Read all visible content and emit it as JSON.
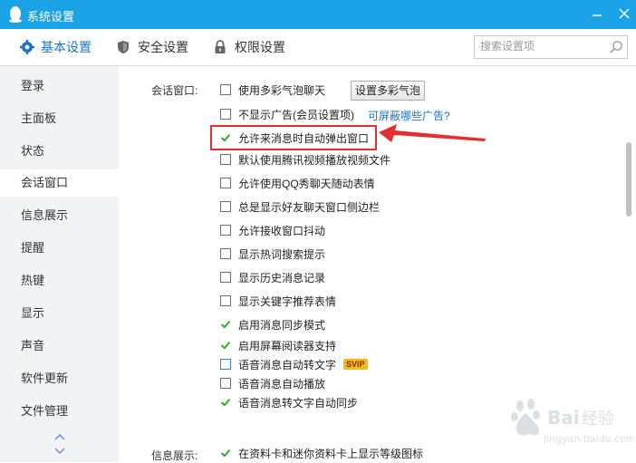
{
  "window": {
    "title": "系统设置"
  },
  "tabs": [
    {
      "label": "基本设置",
      "icon": "gear-icon"
    },
    {
      "label": "安全设置",
      "icon": "shield-icon"
    },
    {
      "label": "权限设置",
      "icon": "lock-icon"
    }
  ],
  "search": {
    "placeholder": "搜索设置项"
  },
  "sidebar": {
    "items": [
      {
        "label": "登录"
      },
      {
        "label": "主面板"
      },
      {
        "label": "状态"
      },
      {
        "label": "会话窗口"
      },
      {
        "label": "信息展示"
      },
      {
        "label": "提醒"
      },
      {
        "label": "热键"
      },
      {
        "label": "显示"
      },
      {
        "label": "声音"
      },
      {
        "label": "软件更新"
      },
      {
        "label": "文件管理"
      }
    ],
    "active": "会话窗口"
  },
  "content": {
    "session_label": "会话窗口:",
    "session_options": [
      {
        "label": "使用多彩气泡聊天",
        "checked": false
      },
      {
        "label": "不显示广告(会员设置项)",
        "checked": false
      },
      {
        "label": "允许来消息时自动弹出窗口",
        "checked": true
      },
      {
        "label": "默认使用腾讯视频播放视频文件",
        "checked": false
      },
      {
        "label": "允许使用QQ秀聊天随动表情",
        "checked": false
      },
      {
        "label": "总是显示好友聊天窗口侧边栏",
        "checked": false
      },
      {
        "label": "允许接收窗口抖动",
        "checked": false
      },
      {
        "label": "显示热词搜索提示",
        "checked": false
      },
      {
        "label": "显示历史消息记录",
        "checked": false
      },
      {
        "label": "显示关键字推荐表情",
        "checked": false
      },
      {
        "label": "启用消息同步模式",
        "checked": true
      },
      {
        "label": "启用屏幕阅读器支持",
        "checked": true
      },
      {
        "label": "语音消息自动转文字",
        "checked": false
      },
      {
        "label": "语音消息自动播放",
        "checked": false
      },
      {
        "label": "语音消息转文字自动同步",
        "checked": true
      }
    ],
    "bubble_button": "设置多彩气泡",
    "ad_link": "可屏蔽哪些广告?",
    "svip_badge": "SVIP",
    "info_label": "信息展示:",
    "info_options": [
      {
        "label": "在资料卡和迷你资料卡上显示等级图标",
        "checked": true
      }
    ]
  },
  "colors": {
    "titlebar": "#1aa3e6",
    "accent": "#1a73c8",
    "check": "#3aa53a",
    "highlight": "#e23030"
  }
}
